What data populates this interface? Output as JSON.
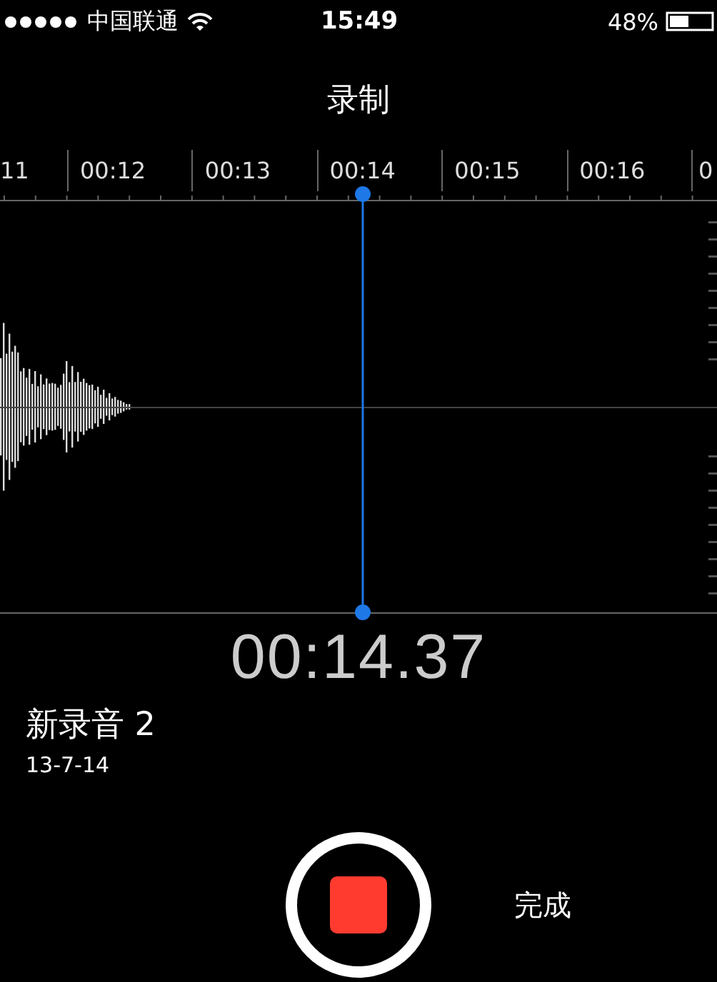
{
  "status_bar": {
    "carrier": "中国联通",
    "time": "15:49",
    "battery": "48%"
  },
  "title": "录制",
  "timeline": {
    "labels": [
      "11",
      "00:12",
      "00:13",
      "00:14",
      "00:15",
      "00:16",
      "0"
    ]
  },
  "elapsed": "00:14.37",
  "recording": {
    "name": "新录音 2",
    "date": "13-7-14"
  },
  "record_button": {
    "recording": true
  },
  "done_button": "完成"
}
